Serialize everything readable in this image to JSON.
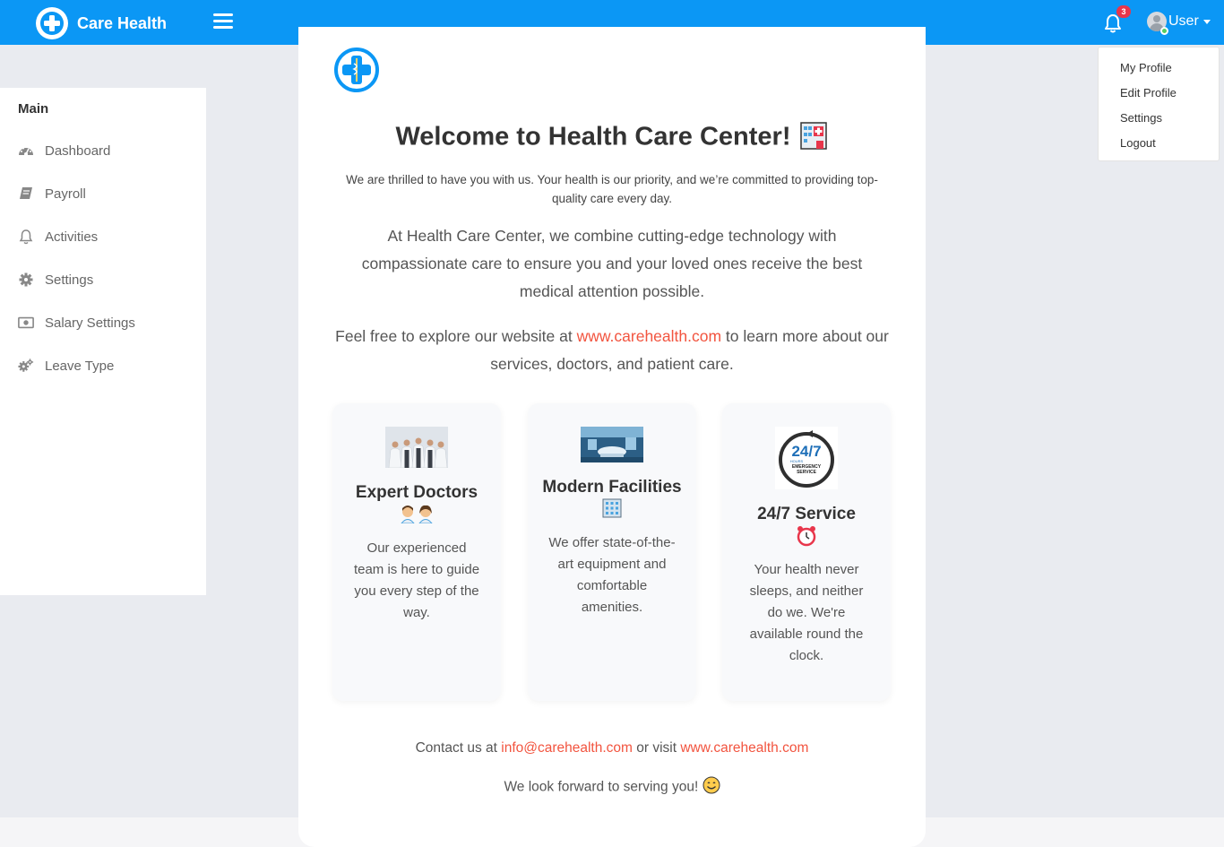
{
  "header": {
    "brand": "Care Health",
    "notification_count": "3",
    "user_label": "User",
    "brand_color": "#0b97f5"
  },
  "dropdown": {
    "items": [
      "My Profile",
      "Edit Profile",
      "Settings",
      "Logout"
    ]
  },
  "sidebar": {
    "section_title": "Main",
    "items": [
      {
        "label": "Dashboard",
        "icon": "dashboard-icon"
      },
      {
        "label": "Payroll",
        "icon": "book-icon"
      },
      {
        "label": "Activities",
        "icon": "bell-icon"
      },
      {
        "label": "Settings",
        "icon": "gear-icon"
      },
      {
        "label": "Salary Settings",
        "icon": "money-icon"
      },
      {
        "label": "Leave Type",
        "icon": "gears-icon"
      }
    ]
  },
  "main": {
    "title": "Welcome to Health Care Center!",
    "intro": "We are thrilled to have you with us. Your health is our priority, and we’re committed to providing top-quality care every day.",
    "para1": "At Health Care Center, we combine cutting-edge technology with compassionate care to ensure you and your loved ones receive the best medical attention possible.",
    "para2_before": "Feel free to explore our website at ",
    "para2_link": "www.carehealth.com",
    "para2_after": " to learn more about our services, doctors, and patient care.",
    "features": [
      {
        "title": "Expert Doctors",
        "text": "Our experienced team is here to guide you every step of the way."
      },
      {
        "title": "Modern Facilities",
        "text": "We offer state-of-the-art equipment and comfortable amenities."
      },
      {
        "title": "24/7 Service",
        "text": "Your health never sleeps, and neither do we. We're available round the clock."
      }
    ],
    "contact_before": "Contact us at ",
    "contact_email": "info@carehealth.com",
    "contact_middle": " or visit ",
    "contact_link": "www.carehealth.com",
    "closing": "We look forward to serving you!",
    "badge_247": "24/7",
    "badge_hours": "HOURS",
    "badge_line1": "EMERGENCY",
    "badge_line2": "SERVICE",
    "accent_color": "#f2543f"
  }
}
